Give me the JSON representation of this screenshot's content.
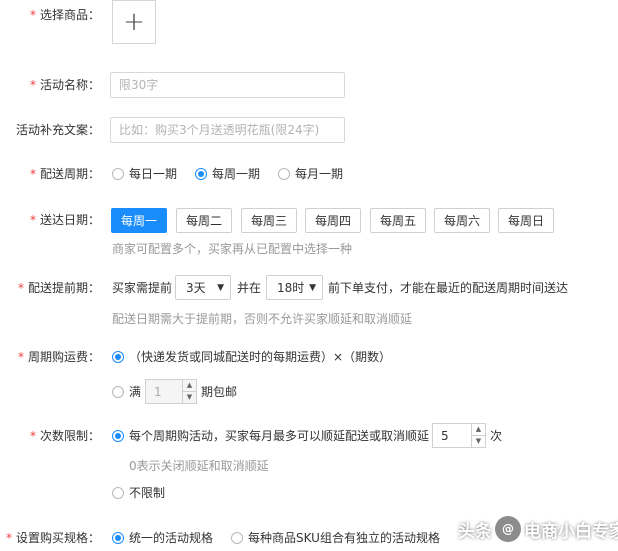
{
  "labels": {
    "select_goods": "选择商品：",
    "activity_name": "活动名称：",
    "activity_supplement": "活动补充文案：",
    "delivery_cycle": "配送周期：",
    "delivery_date": "送达日期：",
    "delivery_advance": "配送提前期：",
    "cycle_shipping": "周期购运费：",
    "times_limit": "次数限制：",
    "purchase_spec": "设置购买规格："
  },
  "activity_name": {
    "value": "",
    "placeholder": "限30字"
  },
  "activity_supplement": {
    "value": "",
    "placeholder": "比如：购买3个月送透明花瓶(限24字)"
  },
  "delivery_cycle": {
    "options": [
      "每日一期",
      "每周一期",
      "每月一期"
    ],
    "selected": 1
  },
  "delivery_date": {
    "days": [
      "每周一",
      "每周二",
      "每周三",
      "每周四",
      "每周五",
      "每周六",
      "每周日"
    ],
    "selected": [
      0
    ],
    "hint": "商家可配置多个，买家再从已配置中选择一种"
  },
  "advance": {
    "prefix": "买家需提前",
    "days_value": "3天",
    "mid": "并在",
    "hour_value": "18时",
    "suffix": "前下单支付，才能在最近的配送周期时间送达",
    "hint": "配送日期需大于提前期，否则不允许买家顺延和取消顺延"
  },
  "shipping": {
    "formula": "（快递发货或同城配送时的每期运费）×（期数）",
    "free_prefix": "满",
    "free_value": "1",
    "free_suffix": "期包邮",
    "selected": 0
  },
  "limit": {
    "per_activity_text": "每个周期购活动，买家每月最多可以顺延配送或取消顺延",
    "count_value": "5",
    "unit": "次",
    "hint": "0表示关闭顺延和取消顺延",
    "unlimited": "不限制",
    "selected": 0
  },
  "spec": {
    "options": [
      "统一的活动规格",
      "每种商品SKU组合有独立的活动规格"
    ],
    "selected": 0
  },
  "icons": {
    "add": "plus-icon"
  },
  "watermark": {
    "prefix": "头条",
    "logo_text": "@",
    "name": "电商小白专家"
  },
  "colors": {
    "accent": "#1a8cfb",
    "required": "#f0413d",
    "hint": "#999999"
  }
}
